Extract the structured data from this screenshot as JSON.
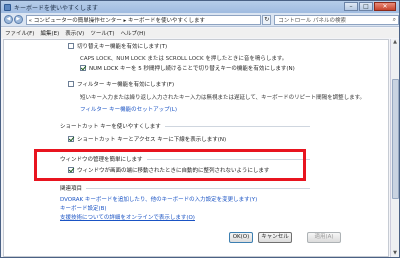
{
  "window": {
    "title": "キーボードを使いやすくします"
  },
  "address": {
    "breadcrumb": "« コンピューターの簡単操作センター ▸ キーボードを使いやすくします",
    "search_placeholder": "コントロール パネルの検索"
  },
  "menu": [
    "ファイル(F)",
    "編集(E)",
    "表示(V)",
    "ツール(T)",
    "ヘルプ(H)"
  ],
  "content": {
    "toggle_keys": {
      "label": "切り替えキー機能を有効にします(T)",
      "desc": "CAPS LOCK、NUM LOCK または SCROLL LOCK を押したときに音を鳴らします。",
      "sub_label": "NUM LOCK キーを 5 秒間押し続けることで切り替えキーの機能を有効にします(N)"
    },
    "filter_keys": {
      "label": "フィルター キー機能を有効にします(F)",
      "desc": "短いキー入力または繰り返し入力されたキー入力は無視または遅延して、キーボードのリピート間隔を調整します。",
      "link": "フィルター キー機能のセットアップ(L)"
    },
    "shortcuts": {
      "title": "ショートカット キーを使いやすくします",
      "label": "ショートカット キーとアクセス キーに下線を表示します(N)"
    },
    "window_mgmt": {
      "title": "ウィンドウの管理を簡単にします",
      "label": "ウィンドウが画面の端に移動されたときに自動的に整列されないようにします"
    },
    "related": {
      "title": "関連項目",
      "links": [
        "DVORAK キーボードを追加したり、他のキーボードの入力設定を変更します(Y)",
        "キーボード設定(B)",
        "支援技術についての詳細をオンラインで表示します(O)"
      ]
    }
  },
  "buttons": {
    "ok": "OK(O)",
    "cancel": "キャンセル",
    "apply": "適用(A)"
  }
}
